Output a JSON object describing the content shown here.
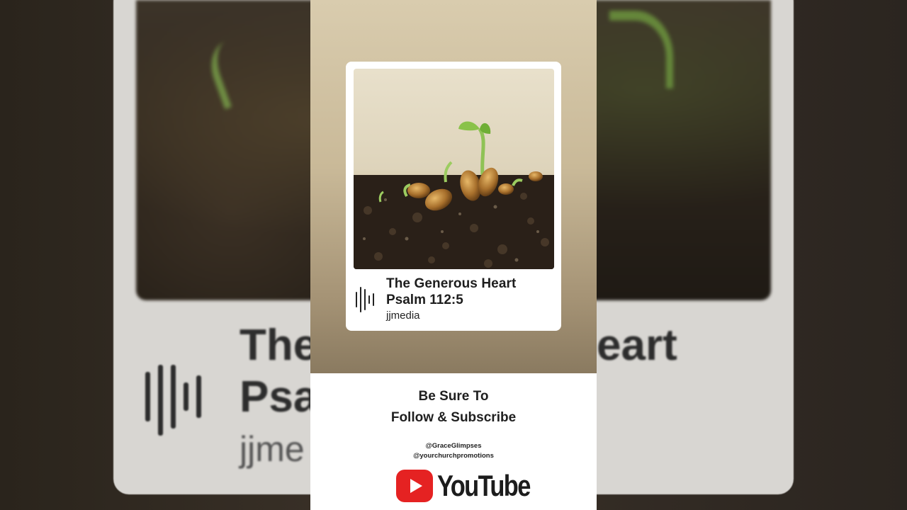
{
  "background": {
    "title_line1_left": "The",
    "title_line1_right": "eart",
    "title_line2": "Psa",
    "author": "jjme"
  },
  "card": {
    "icon": "audio-waveform-icon",
    "title": "The Generous Heart",
    "subtitle": "Psalm 112:5",
    "author": "jjmedia"
  },
  "cta": {
    "line1": "Be Sure To",
    "line2": "Follow & Subscribe",
    "handle1": "@GraceGlimpses",
    "handle2": "@yourchurchpromotions",
    "brand": "YouTube",
    "brand_icon": "youtube-play-icon",
    "brand_color": "#e52222"
  }
}
